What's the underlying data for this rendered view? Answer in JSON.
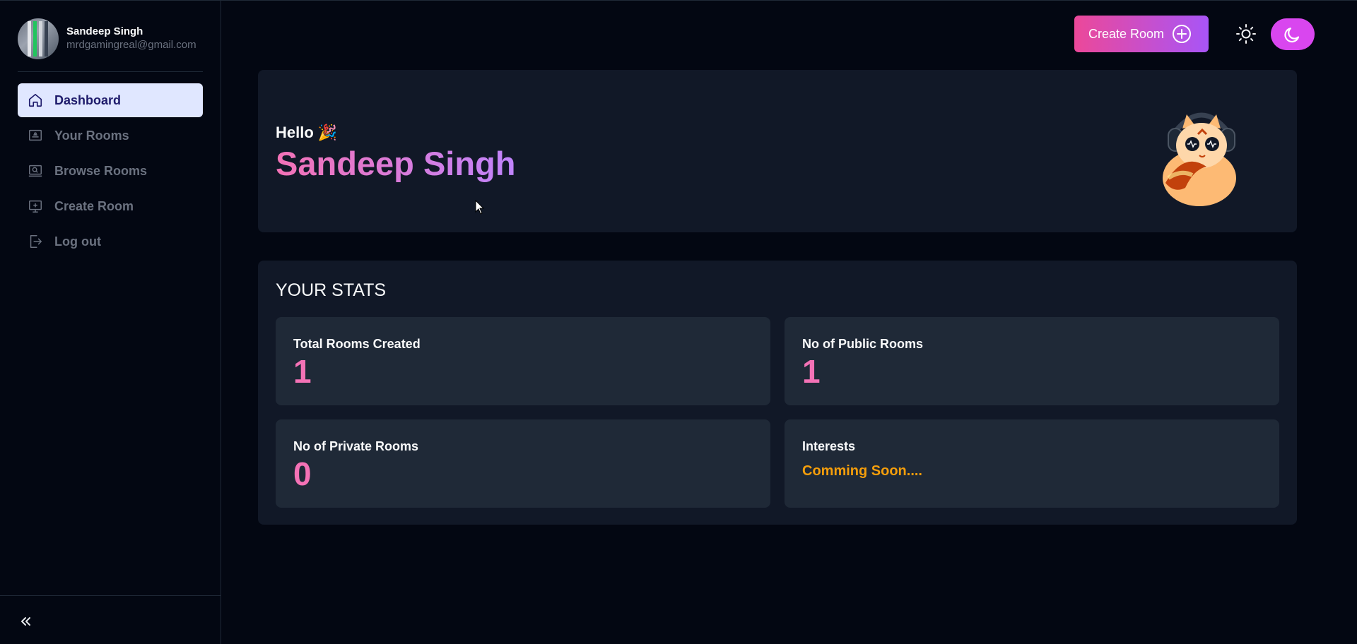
{
  "user": {
    "name": "Sandeep Singh",
    "email": "mrdgamingreal@gmail.com"
  },
  "sidebar": {
    "items": [
      {
        "label": "Dashboard",
        "icon": "home-icon",
        "active": true
      },
      {
        "label": "Your Rooms",
        "icon": "rooms-icon",
        "active": false
      },
      {
        "label": "Browse Rooms",
        "icon": "browse-icon",
        "active": false
      },
      {
        "label": "Create Room",
        "icon": "create-room-icon",
        "active": false
      },
      {
        "label": "Log out",
        "icon": "logout-icon",
        "active": false
      }
    ]
  },
  "header": {
    "create_label": "Create Room"
  },
  "hero": {
    "greeting": "Hello",
    "emoji": "🎉",
    "name": "Sandeep Singh"
  },
  "stats": {
    "title": "YOUR STATS",
    "cards": [
      {
        "label": "Total Rooms Created",
        "value": "1"
      },
      {
        "label": "No of Public Rooms",
        "value": "1"
      },
      {
        "label": "No of Private Rooms",
        "value": "0"
      },
      {
        "label": "Interests",
        "value": "Comming Soon...."
      }
    ]
  },
  "colors": {
    "accent_pink": "#f472b6",
    "accent_purple": "#c084fc",
    "warning": "#f59e0b",
    "active_nav_bg": "#e0e7ff"
  }
}
